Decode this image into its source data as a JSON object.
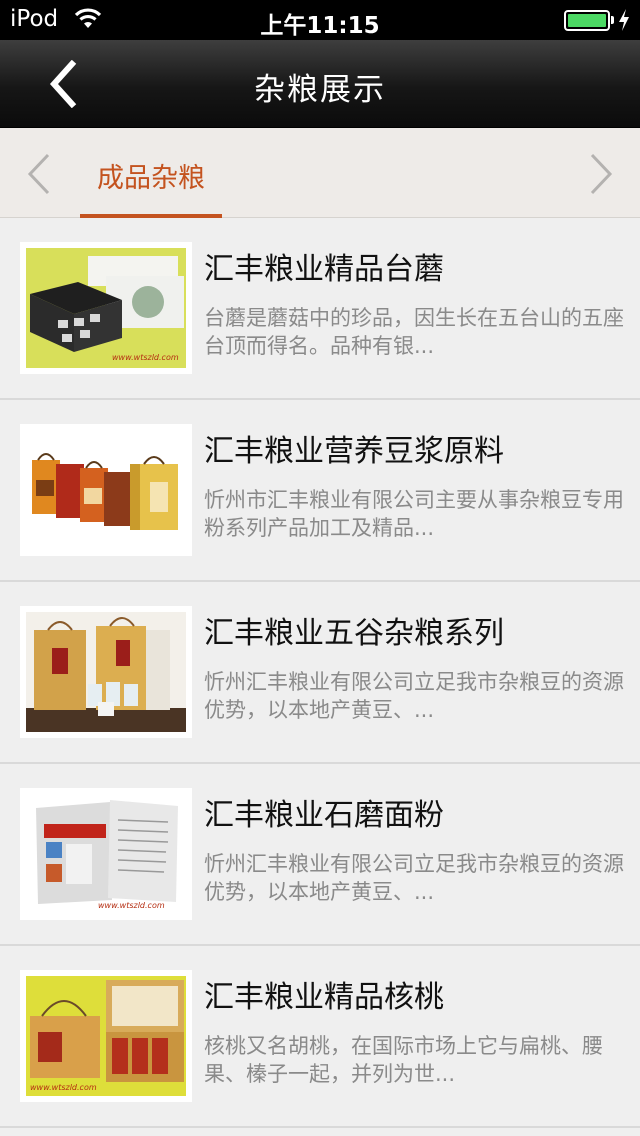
{
  "status_bar": {
    "carrier": "iPod",
    "time": "上午11:15",
    "battery_level": 1.0
  },
  "nav": {
    "title": "杂粮展示",
    "back_icon": "chevron-left-icon"
  },
  "tabs": {
    "active_label": "成品杂粮",
    "accent": "#c4531f"
  },
  "items": [
    {
      "name": "汇丰粮业精品台蘑",
      "desc": "台蘑是蘑菇中的珍品，因生长在五台山的五座台顶而得名。品种有银...",
      "watermark": "www.wtszld.com"
    },
    {
      "name": "汇丰粮业营养豆浆原料",
      "desc": "忻州市汇丰粮业有限公司主要从事杂粮豆专用粉系列产品加工及精品...",
      "watermark": ""
    },
    {
      "name": "汇丰粮业五谷杂粮系列",
      "desc": "忻州汇丰粮业有限公司立足我市杂粮豆的资源优势，以本地产黄豆、...",
      "watermark": ""
    },
    {
      "name": "汇丰粮业石磨面粉",
      "desc": "忻州汇丰粮业有限公司立足我市杂粮豆的资源优势，以本地产黄豆、...",
      "watermark": "www.wtszld.com"
    },
    {
      "name": "汇丰粮业精品核桃",
      "desc": "核桃又名胡桃，在国际市场上它与扁桃、腰果、榛子一起，并列为世...",
      "watermark": "www.wtszld.com"
    }
  ]
}
